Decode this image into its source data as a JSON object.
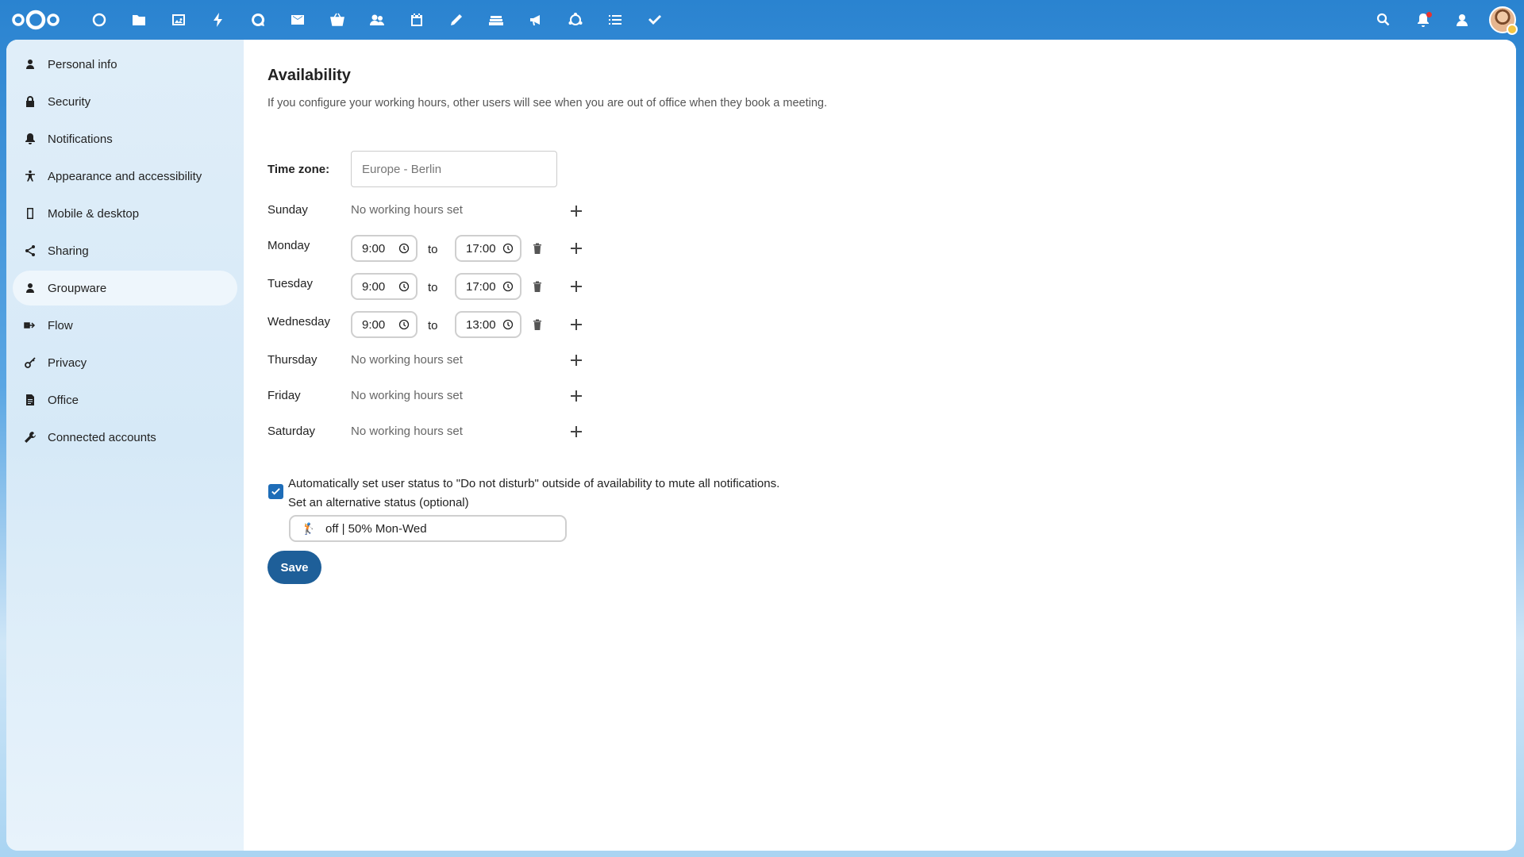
{
  "header": {
    "apps": [
      "dashboard-icon",
      "files-icon",
      "photos-icon",
      "activity-icon",
      "talk-icon",
      "mail-icon",
      "deck-icon",
      "contacts-icon",
      "calendar-icon",
      "notes-icon",
      "stack-icon",
      "announcements-icon",
      "circles-icon",
      "tasks-list-icon",
      "checkmark-icon"
    ],
    "right": [
      "search-icon",
      "notifications-icon",
      "contacts-menu-icon"
    ]
  },
  "sidebar": {
    "items": [
      {
        "label": "Personal info",
        "icon": "person-icon"
      },
      {
        "label": "Security",
        "icon": "lock-icon"
      },
      {
        "label": "Notifications",
        "icon": "bell-icon"
      },
      {
        "label": "Appearance and accessibility",
        "icon": "accessibility-icon"
      },
      {
        "label": "Mobile & desktop",
        "icon": "phone-icon"
      },
      {
        "label": "Sharing",
        "icon": "share-icon"
      },
      {
        "label": "Groupware",
        "icon": "groupware-icon"
      },
      {
        "label": "Flow",
        "icon": "flow-icon"
      },
      {
        "label": "Privacy",
        "icon": "key-icon"
      },
      {
        "label": "Office",
        "icon": "document-icon"
      },
      {
        "label": "Connected accounts",
        "icon": "wrench-icon"
      }
    ],
    "active": "Groupware"
  },
  "main": {
    "title": "Availability",
    "description": "If you configure your working hours, other users will see when you are out of office when they book a meeting.",
    "timezone_label": "Time zone:",
    "timezone_value": "Europe - Berlin",
    "to_label": "to",
    "no_hours": "No working hours set",
    "days": [
      {
        "name": "Sunday",
        "start": null,
        "end": null
      },
      {
        "name": "Monday",
        "start": "9:00",
        "end": "17:00"
      },
      {
        "name": "Tuesday",
        "start": "9:00",
        "end": "17:00"
      },
      {
        "name": "Wednesday",
        "start": "9:00",
        "end": "13:00"
      },
      {
        "name": "Thursday",
        "start": null,
        "end": null
      },
      {
        "name": "Friday",
        "start": null,
        "end": null
      },
      {
        "name": "Saturday",
        "start": null,
        "end": null
      }
    ],
    "dnd_checked": true,
    "dnd_label": "Automatically set user status to \"Do not disturb\" outside of availability to mute all notifications.",
    "alt_status_label": "Set an alternative status (optional)",
    "alt_status_value": "off | 50% Mon-Wed",
    "alt_status_emoji": "🏌",
    "save_label": "Save"
  },
  "colors": {
    "primary": "#1e5f99",
    "checkbox": "#1e6db8",
    "header_bg": "#2a83d0"
  }
}
